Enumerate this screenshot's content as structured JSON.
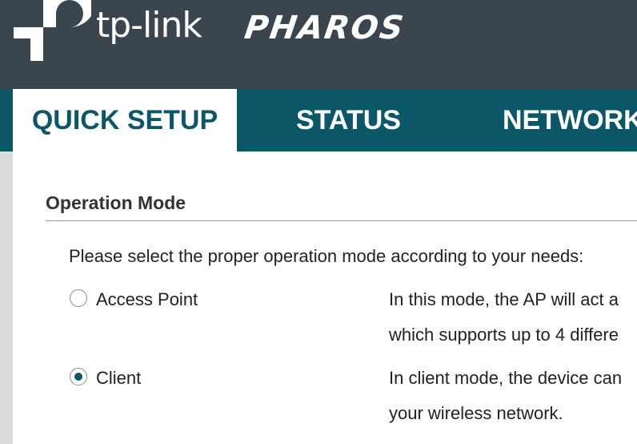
{
  "header": {
    "brand_text": "tp-link",
    "product_text": "PHAROS"
  },
  "nav": {
    "tabs": [
      {
        "label": "QUICK SETUP",
        "active": true
      },
      {
        "label": "STATUS",
        "active": false
      },
      {
        "label": "NETWORK",
        "active": false
      }
    ]
  },
  "section": {
    "title": "Operation Mode",
    "instruction": "Please select the proper operation mode according to your needs:"
  },
  "modes": [
    {
      "label": "Access Point",
      "selected": false,
      "description_line1": "In this mode, the AP will act a",
      "description_line2": "which supports up to 4 differe"
    },
    {
      "label": "Client",
      "selected": true,
      "description_line1": "In client mode, the device can",
      "description_line2": "your wireless network."
    }
  ],
  "colors": {
    "header_bg": "#3b454d",
    "nav_bg": "#0b5667",
    "accent": "#0b5667"
  }
}
